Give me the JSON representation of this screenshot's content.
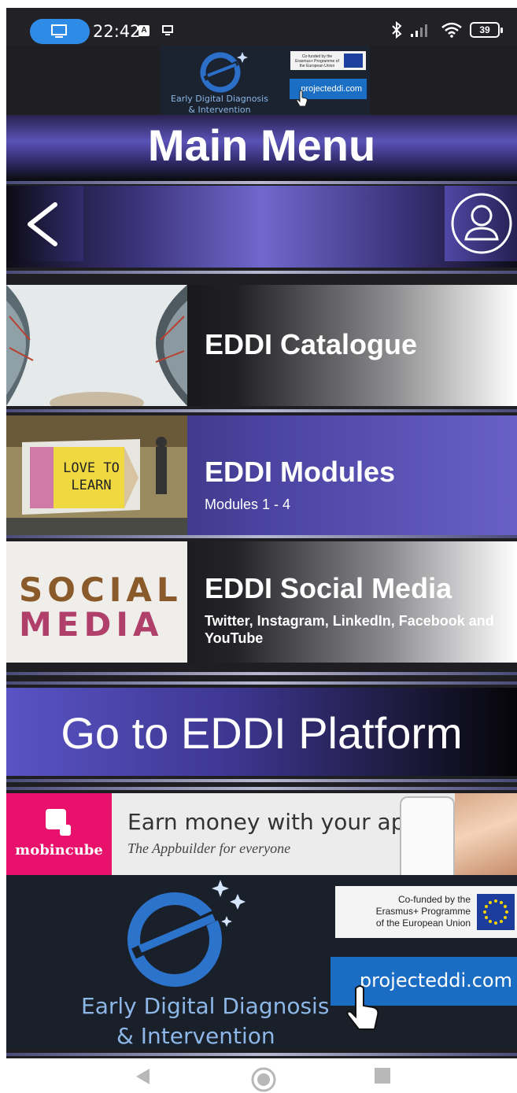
{
  "status_bar": {
    "time": "22:42",
    "battery": "39",
    "icons": [
      "monitor-icon",
      "a-badge-icon",
      "screen-icon",
      "bluetooth-icon",
      "signal-icon",
      "wifi-icon",
      "battery-icon"
    ]
  },
  "top_banner": {
    "logo_text_line1": "Early Digital Diagnosis",
    "logo_text_line2": "& Intervention",
    "eu_text": "Co-funded by the Erasmus+ Programme of the European Union",
    "site": "projecteddi.com"
  },
  "header": {
    "title": "Main Menu"
  },
  "navbar": {
    "icons": [
      "back-arrow-icon",
      "profile-icon"
    ]
  },
  "menu": {
    "items": [
      {
        "title": "EDDI Catalogue",
        "subtitle": ""
      },
      {
        "title": "EDDI Modules",
        "subtitle": "Modules 1 - 4"
      },
      {
        "title": "EDDI Social Media",
        "subtitle": "Twitter, Instagram, LinkedIn, Facebook and YouTube"
      }
    ],
    "thumb_texts": {
      "learn_line1": "LOVE TO",
      "learn_line2": "LEARN",
      "social_line1": "SOCIAL",
      "social_line2": "MEDIA"
    }
  },
  "platform_button": {
    "label": "Go to EDDI Platform"
  },
  "ad": {
    "brand": "mobincube",
    "headline": "Earn money with your apps",
    "tagline": "The Appbuilder for everyone"
  },
  "bottom_banner": {
    "logo_text_line1": "Early Digital Diagnosis",
    "logo_text_line2": "& Intervention",
    "eu_line1": "Co-funded by the",
    "eu_line2": "Erasmus+ Programme",
    "eu_line3": "of the European Union",
    "site": "projecteddi.com"
  },
  "colors": {
    "accent_purple": "#5a53b8",
    "link_blue": "#1a6dc3",
    "ad_pink": "#e8116b"
  }
}
